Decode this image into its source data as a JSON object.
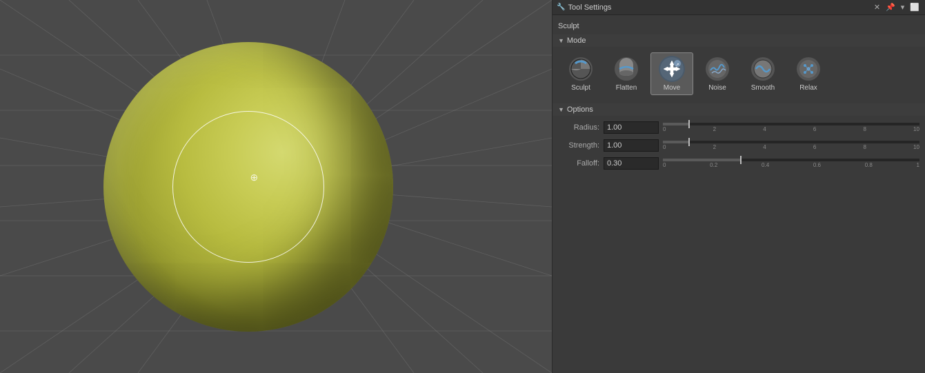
{
  "panel": {
    "title": "Tool Settings",
    "sculpt_label": "Sculpt",
    "mode_section": "Mode",
    "options_section": "Options"
  },
  "modes": [
    {
      "id": "sculpt",
      "label": "Sculpt",
      "active": false,
      "icon": "sculpt"
    },
    {
      "id": "flatten",
      "label": "Flatten",
      "active": false,
      "icon": "flatten"
    },
    {
      "id": "move",
      "label": "Move",
      "active": true,
      "icon": "move"
    },
    {
      "id": "noise",
      "label": "Noise",
      "active": false,
      "icon": "noise"
    },
    {
      "id": "smooth",
      "label": "Smooth",
      "active": false,
      "icon": "smooth"
    },
    {
      "id": "relax",
      "label": "Relax",
      "active": false,
      "icon": "relax"
    }
  ],
  "options": {
    "radius": {
      "label": "Radius:",
      "value": "1.00",
      "min": 0,
      "max": 10,
      "thumb_pct": 10,
      "tick_labels": [
        "0",
        "2",
        "4",
        "6",
        "8",
        "10"
      ]
    },
    "strength": {
      "label": "Strength:",
      "value": "1.00",
      "min": 0,
      "max": 10,
      "thumb_pct": 10,
      "tick_labels": [
        "0",
        "2",
        "4",
        "6",
        "8",
        "10"
      ]
    },
    "falloff": {
      "label": "Falloff:",
      "value": "0.30",
      "min": 0,
      "max": 1,
      "thumb_pct": 30,
      "tick_labels": [
        "0",
        "0.2",
        "0.4",
        "0.6",
        "0.8",
        "1"
      ]
    }
  },
  "cursor_symbol": "⊕"
}
